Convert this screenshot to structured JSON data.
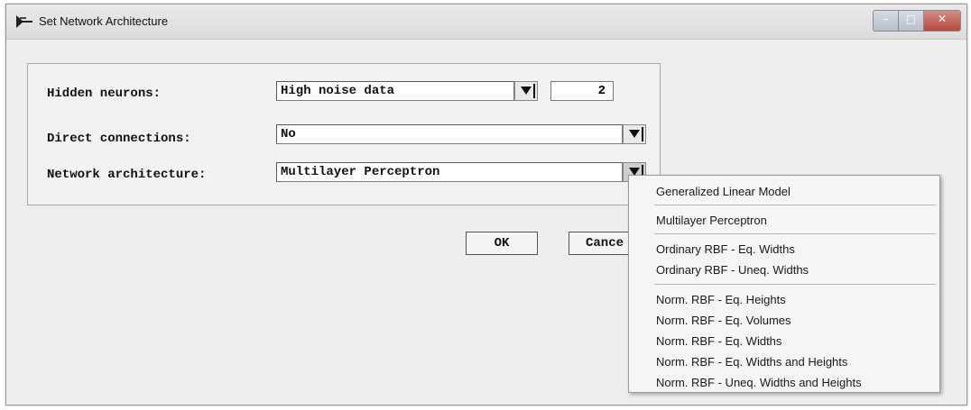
{
  "window": {
    "title": "Set Network Architecture",
    "app_icon": "sas-arrow-icon",
    "controls": {
      "minimize": "–",
      "maximize": "□",
      "close": "✕"
    }
  },
  "form": {
    "hidden_neurons": {
      "label": "Hidden neurons:",
      "value": "High noise data",
      "count": "2"
    },
    "direct_connections": {
      "label": "Direct connections:",
      "value": "No"
    },
    "network_architecture": {
      "label": "Network architecture:",
      "value": "Multilayer Perceptron"
    }
  },
  "buttons": {
    "ok": "OK",
    "cancel": "Cance"
  },
  "dropdown": {
    "items": [
      "Generalized Linear Model",
      "Multilayer Perceptron",
      "Ordinary RBF - Eq. Widths",
      "Ordinary RBF - Uneq. Widths",
      "Norm. RBF - Eq. Heights",
      "Norm. RBF - Eq. Volumes",
      "Norm. RBF - Eq. Widths",
      "Norm. RBF - Eq. Widths and Heights",
      "Norm. RBF - Uneq. Widths and Heights"
    ]
  }
}
